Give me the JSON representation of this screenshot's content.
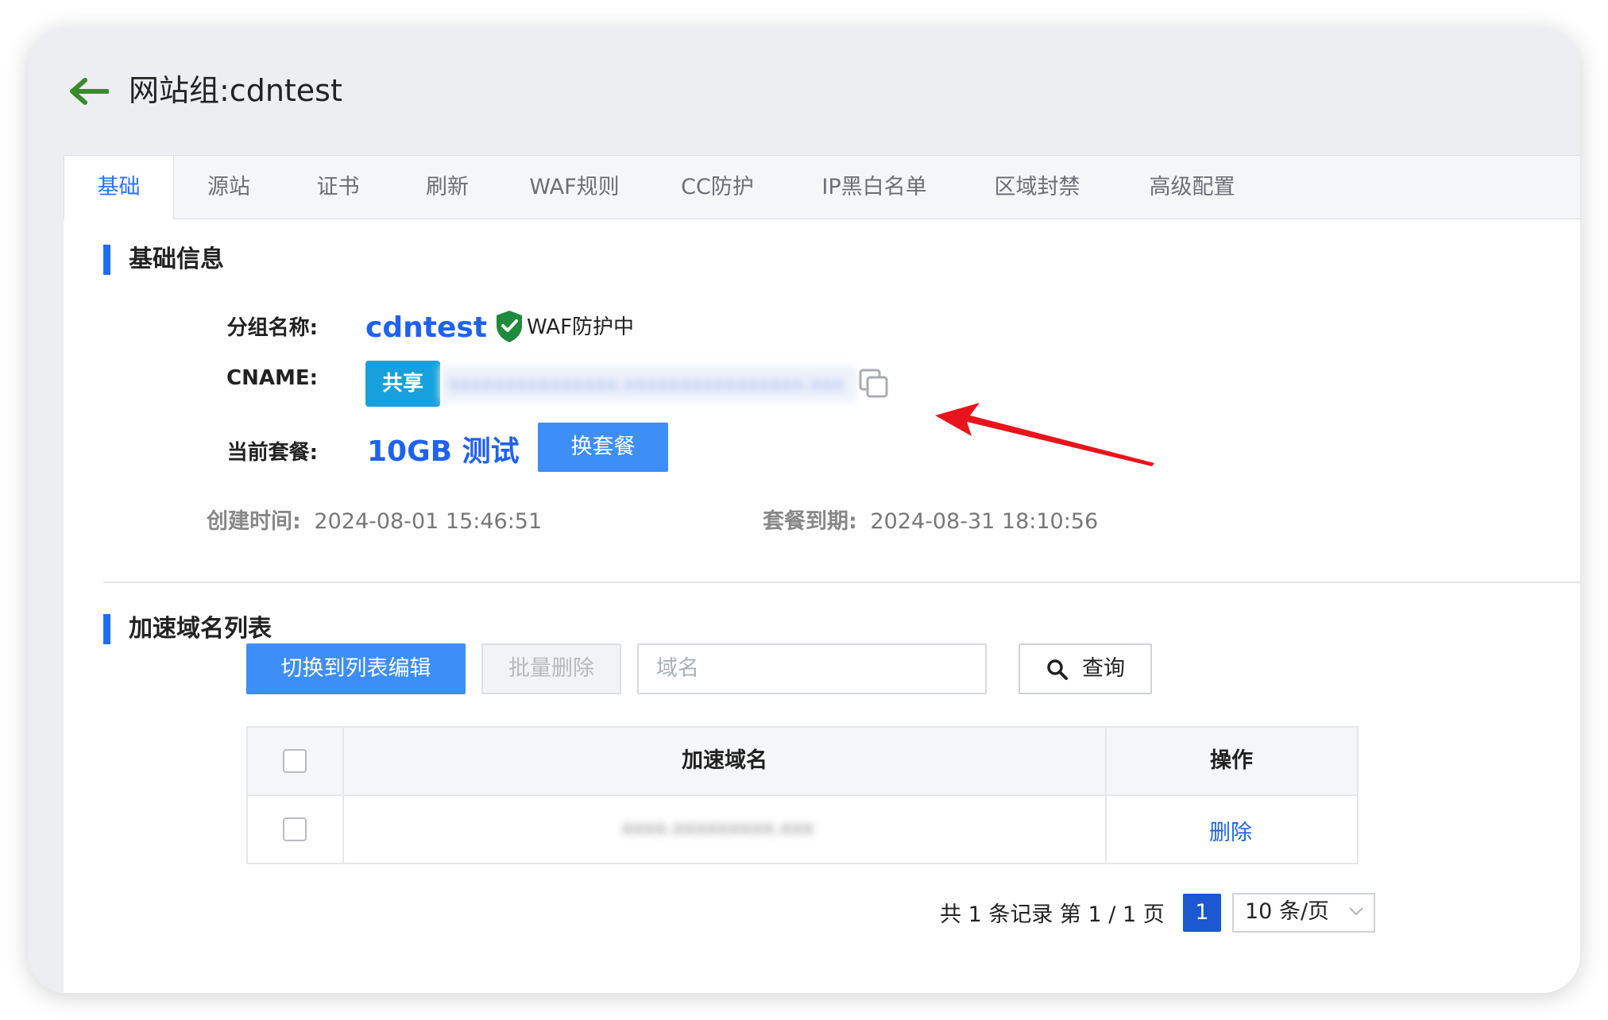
{
  "page": {
    "title": "网站组:cdntest"
  },
  "tabs": [
    {
      "label": "基础",
      "active": true
    },
    {
      "label": "源站"
    },
    {
      "label": "证书"
    },
    {
      "label": "刷新"
    },
    {
      "label": "WAF规则"
    },
    {
      "label": "CC防护"
    },
    {
      "label": "IP黑白名单"
    },
    {
      "label": "区域封禁"
    },
    {
      "label": "高级配置"
    }
  ],
  "basic": {
    "section_title": "基础信息",
    "group_label": "分组名称:",
    "group_name": "cdntest",
    "waf_status": "WAF防护中",
    "cname_label": "CNAME:",
    "share_label": "共享",
    "cname_value": "xxxxxxxxxxxxxxx.xxxxxxxxxxxxxxxx.xxx",
    "plan_label": "当前套餐:",
    "plan_value": "10GB 测试",
    "change_plan_label": "换套餐",
    "created_label": "创建时间:",
    "created_value": "2024-08-01 15:46:51",
    "expire_label": "套餐到期:",
    "expire_value": "2024-08-31 18:10:56"
  },
  "domains": {
    "section_title": "加速域名列表",
    "switch_edit_label": "切换到列表编辑",
    "batch_delete_label": "批量删除",
    "search_placeholder": "域名",
    "query_label": "查询",
    "columns": [
      "加速域名",
      "操作"
    ],
    "rows": [
      {
        "domain": "xxxx.xxxxxxxxx.xxx",
        "action": "删除"
      }
    ]
  },
  "pagination": {
    "summary": "共 1 条记录 第 1 / 1 页",
    "current_page": "1",
    "page_size": "10 条/页"
  },
  "colors": {
    "accent": "#1e62f0",
    "button_blue": "#3d8ef6",
    "share_blue": "#17a0de",
    "waf_green": "#1e8a3c",
    "annotation_red": "#e8141c"
  }
}
